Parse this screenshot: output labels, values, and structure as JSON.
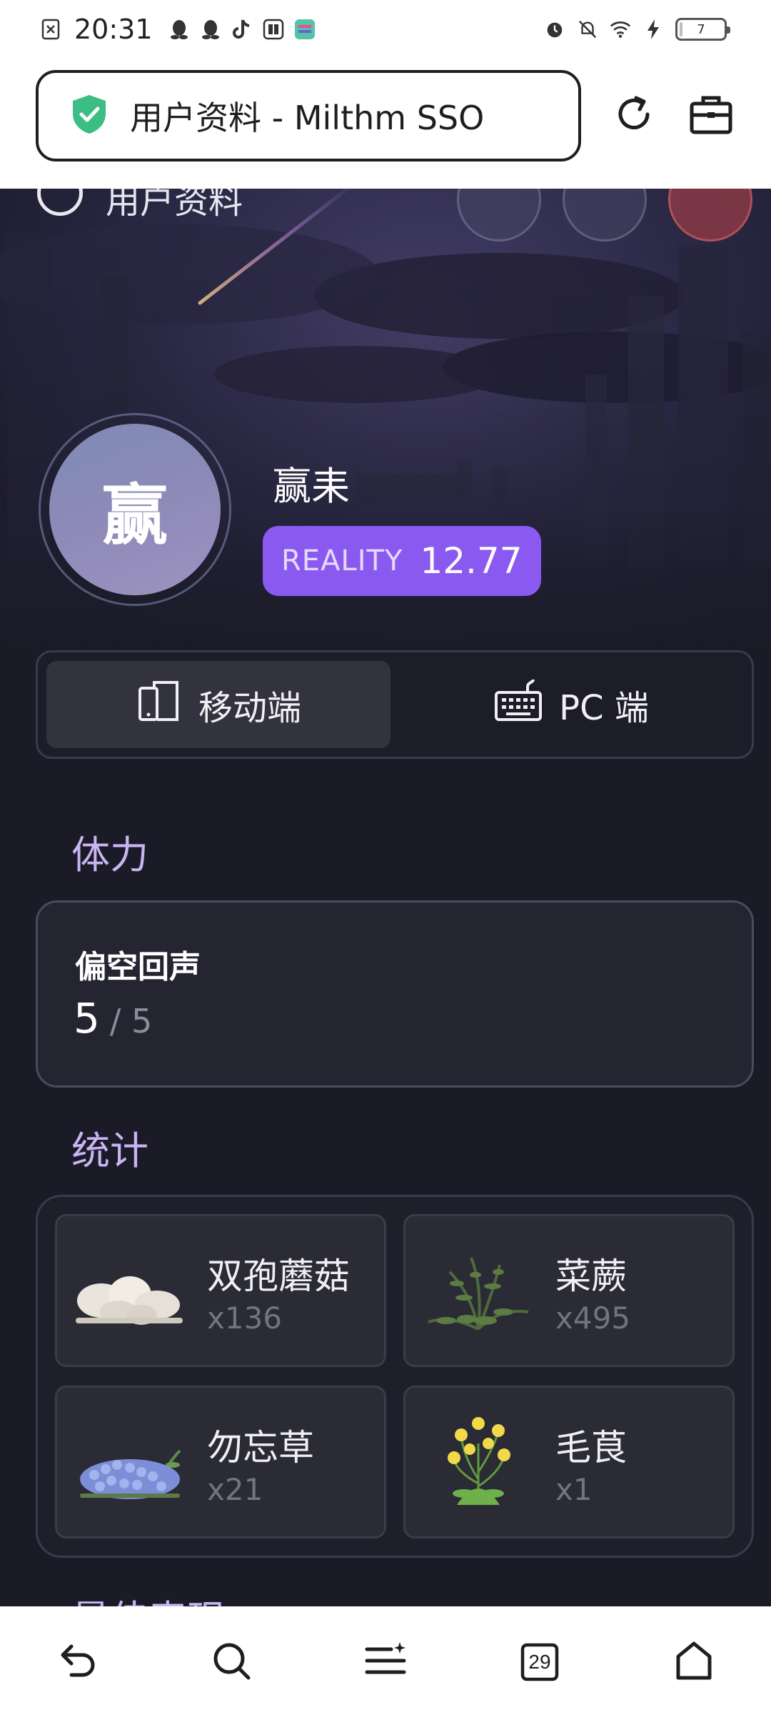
{
  "status_bar": {
    "time": "20:31",
    "left_icons": [
      "close-box-icon",
      "qq-icon",
      "qq-icon",
      "tiktok-icon",
      "tieba-icon",
      "app-icon"
    ],
    "right_icons": [
      "alarm-icon",
      "silent-bell-icon",
      "wifi-icon",
      "charging-icon"
    ],
    "battery": "7",
    "battery_level": 0.07
  },
  "browser": {
    "tab_title": "用户资料 - Milthm SSO",
    "secure_icon": "shield-check-icon",
    "reload_icon": "reload-icon",
    "toolbox_icon": "toolbox-icon"
  },
  "page_nav": {
    "title": "用户资料"
  },
  "profile": {
    "avatar_text": "赢",
    "name": "赢耒",
    "reality_label": "REALITY",
    "reality_value": "12.77"
  },
  "platform_tabs": [
    {
      "label": "移动端",
      "icon": "mobile-icon",
      "active": true
    },
    {
      "label": "PC 端",
      "icon": "keyboard-icon",
      "active": false
    }
  ],
  "stamina": {
    "section_title": "体力",
    "name": "偏空回声",
    "current": "5",
    "max": "/ 5"
  },
  "stats": {
    "section_title": "统计",
    "items": [
      {
        "name": "双孢蘑菇",
        "count": "x136",
        "icon": "mushroom-icon"
      },
      {
        "name": "菜蕨",
        "count": "x495",
        "icon": "fern-icon"
      },
      {
        "name": "勿忘草",
        "count": "x21",
        "icon": "forget-me-not-icon"
      },
      {
        "name": "毛茛",
        "count": "x1",
        "icon": "buttercup-icon"
      }
    ]
  },
  "next_section_title": "最佳表现",
  "bottom_nav": {
    "tabs_count": "29",
    "items": [
      "back-icon",
      "search-icon",
      "menu-sparkle-icon",
      "tabs-icon",
      "home-icon"
    ]
  },
  "colors": {
    "accent": "#8a59f0",
    "section_title": "#c9b5f2",
    "background": "#1b1b28",
    "card": "#252532",
    "shield": "#3bbd84"
  }
}
